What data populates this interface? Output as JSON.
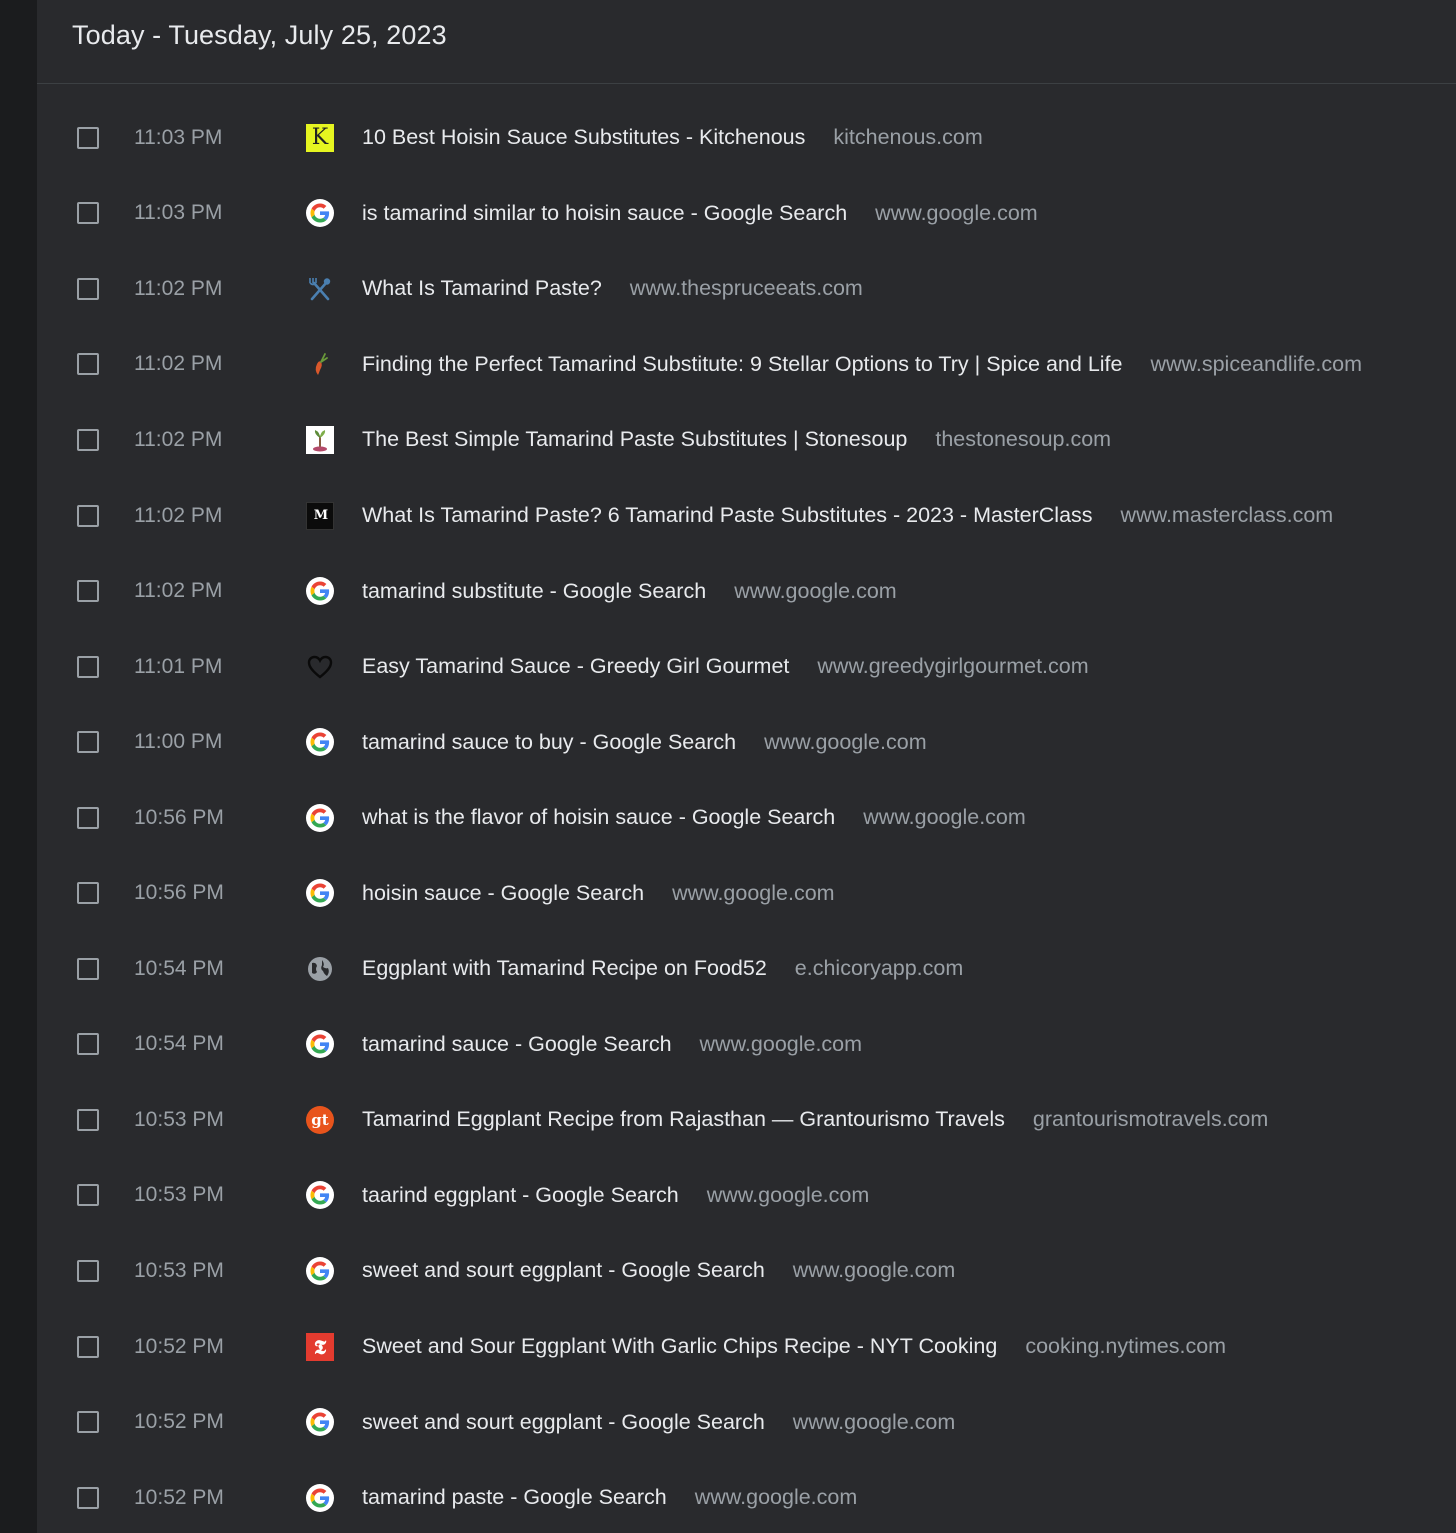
{
  "header": {
    "title": "Today - Tuesday, July 25, 2023"
  },
  "entries": [
    {
      "time": "11:03 PM",
      "title": "10 Best Hoisin Sauce Substitutes - Kitchenous",
      "domain": "kitchenous.com",
      "icon": "kitchenous-k-icon"
    },
    {
      "time": "11:03 PM",
      "title": "is tamarind similar to hoisin sauce - Google Search",
      "domain": "www.google.com",
      "icon": "google-g-icon"
    },
    {
      "time": "11:02 PM",
      "title": "What Is Tamarind Paste?",
      "domain": "www.thespruceeats.com",
      "icon": "spruce-eats-utensils-icon"
    },
    {
      "time": "11:02 PM",
      "title": "Finding the Perfect Tamarind Substitute: 9 Stellar Options to Try | Spice and Life",
      "domain": "www.spiceandlife.com",
      "icon": "spice-and-life-pepper-icon"
    },
    {
      "time": "11:02 PM",
      "title": "The Best Simple Tamarind Paste Substitutes | Stonesoup",
      "domain": "thestonesoup.com",
      "icon": "stonesoup-plant-icon"
    },
    {
      "time": "11:02 PM",
      "title": "What Is Tamarind Paste? 6 Tamarind Paste Substitutes - 2023 - MasterClass",
      "domain": "www.masterclass.com",
      "icon": "masterclass-m-icon"
    },
    {
      "time": "11:02 PM",
      "title": "tamarind substitute - Google Search",
      "domain": "www.google.com",
      "icon": "google-g-icon"
    },
    {
      "time": "11:01 PM",
      "title": "Easy Tamarind Sauce - Greedy Girl Gourmet",
      "domain": "www.greedygirlgourmet.com",
      "icon": "heart-icon"
    },
    {
      "time": "11:00 PM",
      "title": "tamarind sauce to buy - Google Search",
      "domain": "www.google.com",
      "icon": "google-g-icon"
    },
    {
      "time": "10:56 PM",
      "title": "what is the flavor of hoisin sauce - Google Search",
      "domain": "www.google.com",
      "icon": "google-g-icon"
    },
    {
      "time": "10:56 PM",
      "title": "hoisin sauce - Google Search",
      "domain": "www.google.com",
      "icon": "google-g-icon"
    },
    {
      "time": "10:54 PM",
      "title": "Eggplant with Tamarind Recipe on Food52",
      "domain": "e.chicoryapp.com",
      "icon": "globe-icon"
    },
    {
      "time": "10:54 PM",
      "title": "tamarind sauce - Google Search",
      "domain": "www.google.com",
      "icon": "google-g-icon"
    },
    {
      "time": "10:53 PM",
      "title": "Tamarind Eggplant Recipe from Rajasthan — Grantourismo Travels",
      "domain": "grantourismotravels.com",
      "icon": "grantourismo-gt-icon"
    },
    {
      "time": "10:53 PM",
      "title": "taarind eggplant - Google Search",
      "domain": "www.google.com",
      "icon": "google-g-icon"
    },
    {
      "time": "10:53 PM",
      "title": "sweet and sourt eggplant - Google Search",
      "domain": "www.google.com",
      "icon": "google-g-icon"
    },
    {
      "time": "10:52 PM",
      "title": "Sweet and Sour Eggplant With Garlic Chips Recipe - NYT Cooking",
      "domain": "cooking.nytimes.com",
      "icon": "nyt-cooking-t-icon"
    },
    {
      "time": "10:52 PM",
      "title": "sweet and sourt eggplant - Google Search",
      "domain": "www.google.com",
      "icon": "google-g-icon"
    },
    {
      "time": "10:52 PM",
      "title": "tamarind paste - Google Search",
      "domain": "www.google.com",
      "icon": "google-g-icon"
    }
  ],
  "favicon_glyphs": {
    "kitchenous": "K",
    "masterclass": "M",
    "grantourismo": "gt",
    "nyt": "𝕿"
  },
  "colors": {
    "background": "#202124",
    "card": "#292a2d",
    "title_text": "#e8eaed",
    "secondary_text": "#9aa0a6",
    "kitchenous_yellow": "#e6f520",
    "grantourismo_orange": "#e8541c",
    "nyt_red": "#e33b2f"
  }
}
